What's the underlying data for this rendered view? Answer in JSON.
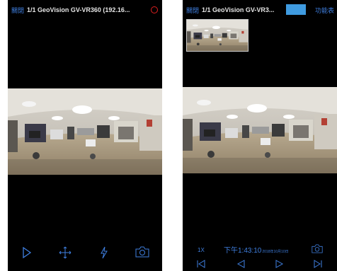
{
  "left_screen": {
    "close_label": "關閉",
    "title": "1/1 GeoVision GV-VR360 (192.16...",
    "toolbar_icons": [
      "play-icon",
      "move-icon",
      "flash-icon",
      "camera-icon"
    ]
  },
  "right_screen": {
    "close_label": "關閉",
    "title": "1/1 GeoVision GV-VR3...",
    "function_label": "功能表",
    "playback": {
      "speed": "1X",
      "time": "下午1:43:10",
      "date": "2018年10月10日"
    },
    "toolbar_icons": [
      "step-back-icon",
      "rewind-icon",
      "play-icon",
      "step-forward-icon"
    ]
  }
}
